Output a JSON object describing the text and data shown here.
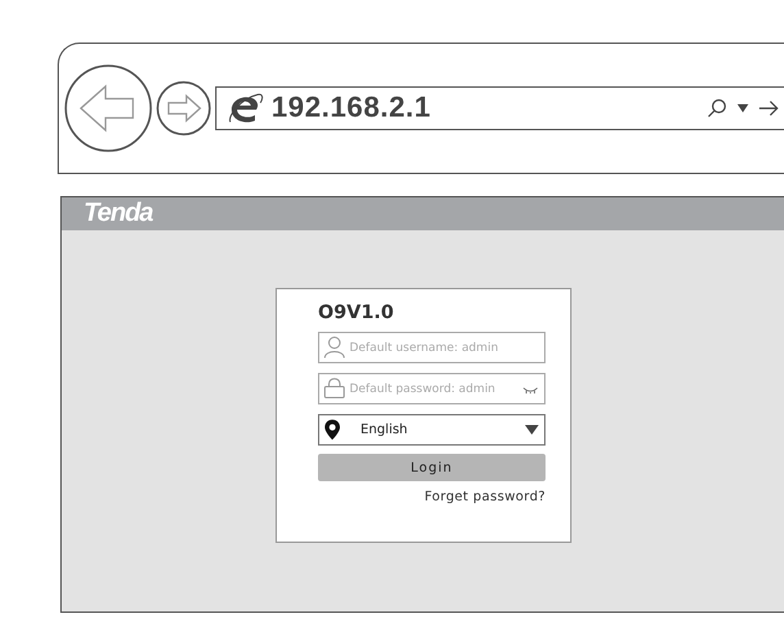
{
  "browser": {
    "address": "192.168.2.1"
  },
  "page": {
    "brand": "Tenda",
    "login": {
      "title": "O9V1.0",
      "username": {
        "placeholder": "Default username: admin"
      },
      "password": {
        "placeholder": "Default password: admin"
      },
      "language": {
        "value": "English"
      },
      "button": "Login",
      "link": "Forget password?"
    }
  }
}
